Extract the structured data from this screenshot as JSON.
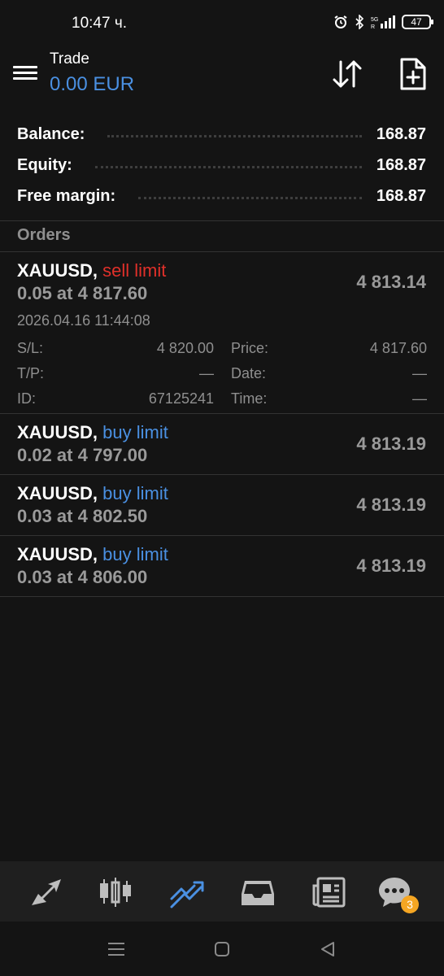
{
  "status_bar": {
    "time": "10:47 ч.",
    "battery": "47"
  },
  "header": {
    "title": "Trade",
    "subtitle": "0.00 EUR"
  },
  "summary": [
    {
      "label": "Balance:",
      "value": "168.87"
    },
    {
      "label": "Equity:",
      "value": "168.87"
    },
    {
      "label": "Free margin:",
      "value": "168.87"
    }
  ],
  "orders_section_title": "Orders",
  "orders": [
    {
      "symbol": "XAUUSD,",
      "type": "sell limit",
      "volume_line": "0.05 at 4 817.60",
      "current_price": "4 813.14",
      "expanded": true,
      "time": "2026.04.16 11:44:08",
      "sl_label": "S/L:",
      "sl_value": "4 820.00",
      "price_label": "Price:",
      "price_value": "4 817.60",
      "tp_label": "T/P:",
      "tp_value": "—",
      "date_label": "Date:",
      "date_value": "—",
      "id_label": "ID:",
      "id_value": "67125241",
      "time_label": "Time:",
      "time_value": "—"
    },
    {
      "symbol": "XAUUSD,",
      "type": "buy limit",
      "volume_line": "0.02 at 4 797.00",
      "current_price": "4 813.19"
    },
    {
      "symbol": "XAUUSD,",
      "type": "buy limit",
      "volume_line": "0.03 at 4 802.50",
      "current_price": "4 813.19"
    },
    {
      "symbol": "XAUUSD,",
      "type": "buy limit",
      "volume_line": "0.03 at 4 806.00",
      "current_price": "4 813.19"
    }
  ],
  "bottom_nav": {
    "items": [
      "quotes-icon",
      "chart-icon",
      "trade-icon",
      "history-icon",
      "news-icon",
      "messages-icon"
    ],
    "active": "trade-icon",
    "messages_badge": "3"
  },
  "colors": {
    "accent_blue": "#4a90e2",
    "sell_red": "#e0302a",
    "badge_orange": "#f5a623",
    "background": "#141414"
  }
}
